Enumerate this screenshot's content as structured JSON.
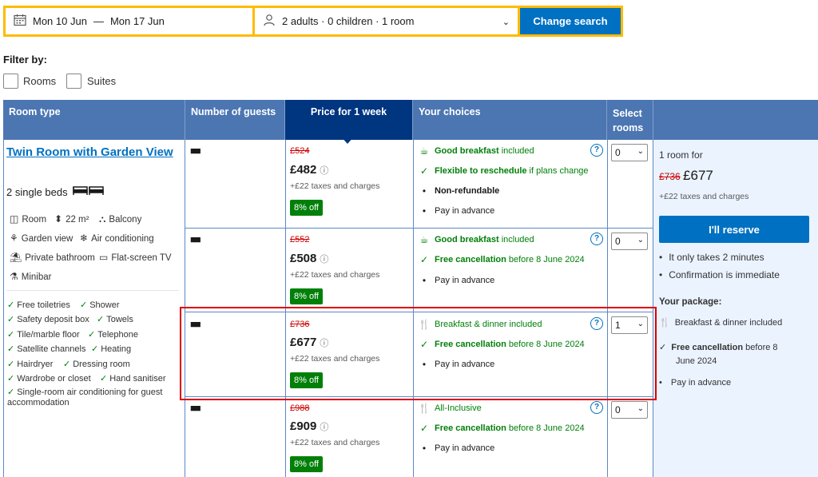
{
  "search": {
    "dates": "Mon 10 Jun",
    "dates_sep": "—",
    "dates_end": "Mon 17 Jun",
    "guests": "2 adults · 0 children · 1 room",
    "button": "Change search"
  },
  "filter": {
    "title": "Filter by:",
    "options": [
      "Rooms",
      "Suites"
    ]
  },
  "table": {
    "headers": [
      "Room type",
      "Number of guests",
      "Price for 1 week",
      "Your choices",
      "Select rooms"
    ],
    "room": {
      "title": "Twin Room with Garden View",
      "beds": "2 single beds",
      "features": [
        "Room",
        "22 m²",
        "Balcony",
        "Garden view",
        "Air conditioning",
        "Private bathroom",
        "Flat-screen TV",
        "Minibar"
      ],
      "amenities": [
        "Free toiletries",
        "Shower",
        "Safety deposit box",
        "Towels",
        "Tile/marble floor",
        "Telephone",
        "Satellite channels",
        "Heating",
        "Hairdryer",
        "Dressing room",
        "Wardrobe or closet",
        "Hand sanitiser",
        "Single-room air conditioning for guest accommodation"
      ]
    },
    "rows": [
      {
        "old": "£524",
        "price": "£482",
        "taxes": "+£22 taxes and charges",
        "deal": "8% off",
        "choices": [
          {
            "bold": "Good breakfast",
            "text": "included",
            "green": true
          },
          {
            "bold": "Flexible to reschedule",
            "text": "if plans change",
            "green": true
          },
          {
            "bold": "Non-refundable",
            "text": "",
            "green": false
          },
          {
            "bold": "",
            "text": "Pay in advance",
            "green": false
          }
        ],
        "select": "0"
      },
      {
        "old": "£552",
        "price": "£508",
        "taxes": "+£22 taxes and charges",
        "deal": "8% off",
        "choices": [
          {
            "bold": "Good breakfast",
            "text": "included",
            "green": true
          },
          {
            "bold": "Free cancellation",
            "text": "before 8 June 2024",
            "green": true
          },
          {
            "bold": "",
            "text": "Pay in advance",
            "green": false
          }
        ],
        "select": "0"
      },
      {
        "old": "£736",
        "price": "£677",
        "taxes": "+£22 taxes and charges",
        "deal": "8% off",
        "choices": [
          {
            "bold": "",
            "text": "Breakfast & dinner included",
            "green": true
          },
          {
            "bold": "Free cancellation",
            "text": "before 8 June 2024",
            "green": true
          },
          {
            "bold": "",
            "text": "Pay in advance",
            "green": false
          }
        ],
        "select": "1"
      },
      {
        "old": "£988",
        "price": "£909",
        "taxes": "+£22 taxes and charges",
        "deal": "8% off",
        "choices": [
          {
            "bold": "",
            "text": "All-Inclusive",
            "green": true
          },
          {
            "bold": "Free cancellation",
            "text": "before 8 June 2024",
            "green": true
          },
          {
            "bold": "",
            "text": "Pay in advance",
            "green": false
          }
        ],
        "select": "0"
      }
    ]
  },
  "summary": {
    "rooms_for": "1 room for",
    "old": "£736",
    "price": "£677",
    "taxes": "+£22 taxes and charges",
    "reserve": "I'll reserve",
    "bullets": [
      "It only takes 2 minutes",
      "Confirmation is immediate"
    ],
    "package_title": "Your package:",
    "package_meal": "Breakfast & dinner included",
    "package_cancel_bold": "Free cancellation",
    "package_cancel_text": "before 8",
    "package_cancel_text2": "June 2024",
    "package_pay": "Pay in advance"
  },
  "colors": {
    "brand_blue": "#0071c2",
    "header_blue": "#4c76b2",
    "selected_header": "#003580",
    "yellow": "#febb02",
    "green": "#008009",
    "red": "#cc0000",
    "highlight": "#e00000"
  }
}
